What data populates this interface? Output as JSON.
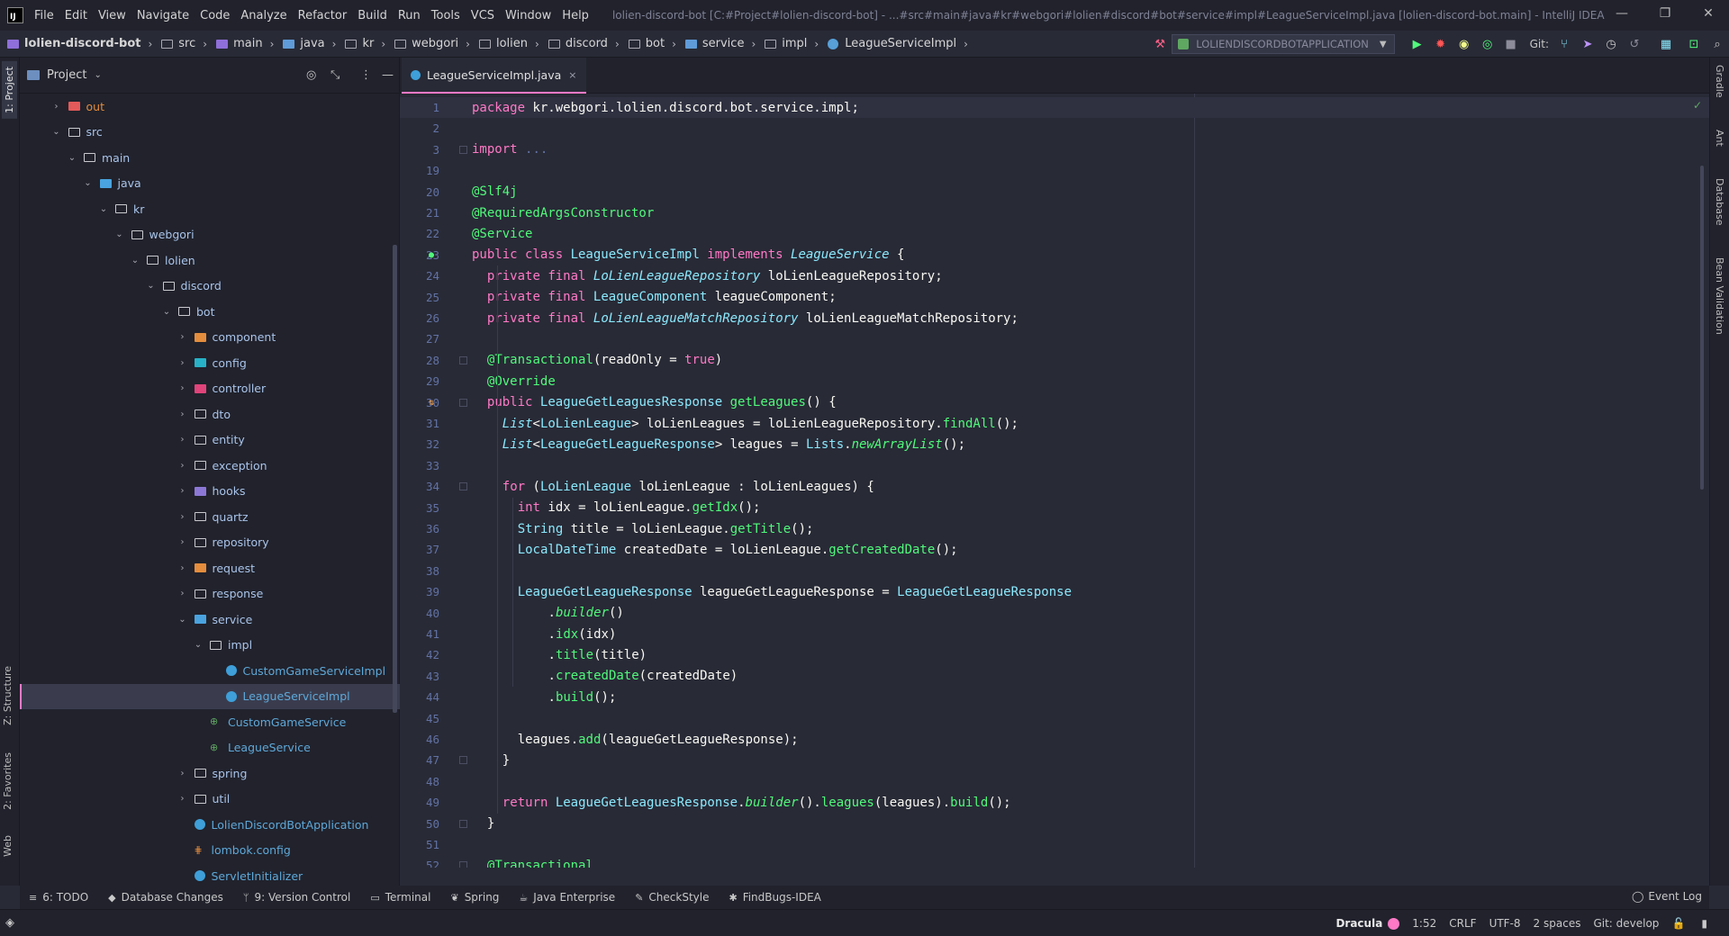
{
  "menubar": {
    "items": [
      "File",
      "Edit",
      "View",
      "Navigate",
      "Code",
      "Analyze",
      "Refactor",
      "Build",
      "Run",
      "Tools",
      "VCS",
      "Window",
      "Help"
    ],
    "window_title": "lolien-discord-bot [C:#Project#lolien-discord-bot] - ...#src#main#java#kr#webgori#lolien#discord#bot#service#impl#LeagueServiceImpl.java [lolien-discord-bot.main] - IntelliJ IDEA",
    "minimize": "—",
    "maximize": "❐",
    "close": "✕"
  },
  "breadcrumbs": [
    "lolien-discord-bot",
    "src",
    "main",
    "java",
    "kr",
    "webgori",
    "lolien",
    "discord",
    "bot",
    "service",
    "impl",
    "LeagueServiceImpl"
  ],
  "toolbar": {
    "run_config": "LOLIENDISCORDBOTAPPLICATION",
    "git_label": "Git:"
  },
  "left_stripe": {
    "project": "1: Project",
    "structure": "Z: Structure",
    "favorites": "2: Favorites",
    "web": "Web"
  },
  "right_stripe": {
    "gradle": "Gradle",
    "ant": "Ant",
    "database": "Database",
    "bean_validation": "Bean Validation"
  },
  "project_panel": {
    "title": "Project",
    "tree": [
      {
        "label": "out",
        "depth": 1,
        "twisty": "›",
        "icon": "red",
        "style": "out"
      },
      {
        "label": "src",
        "depth": 1,
        "twisty": "⌄",
        "icon": "plain",
        "style": "blue"
      },
      {
        "label": "main",
        "depth": 2,
        "twisty": "⌄",
        "icon": "plain",
        "style": "blue"
      },
      {
        "label": "java",
        "depth": 3,
        "twisty": "⌄",
        "icon": "blue",
        "style": "blue"
      },
      {
        "label": "kr",
        "depth": 4,
        "twisty": "⌄",
        "icon": "plain",
        "style": "blue"
      },
      {
        "label": "webgori",
        "depth": 5,
        "twisty": "⌄",
        "icon": "plain",
        "style": "blue"
      },
      {
        "label": "lolien",
        "depth": 6,
        "twisty": "⌄",
        "icon": "plain",
        "style": "blue"
      },
      {
        "label": "discord",
        "depth": 7,
        "twisty": "⌄",
        "icon": "plain",
        "style": "blue"
      },
      {
        "label": "bot",
        "depth": 8,
        "twisty": "⌄",
        "icon": "plain",
        "style": "blue"
      },
      {
        "label": "component",
        "depth": 9,
        "twisty": "›",
        "icon": "orange",
        "style": "blue"
      },
      {
        "label": "config",
        "depth": 9,
        "twisty": "›",
        "icon": "cyan",
        "style": "blue"
      },
      {
        "label": "controller",
        "depth": 9,
        "twisty": "›",
        "icon": "pink",
        "style": "blue"
      },
      {
        "label": "dto",
        "depth": 9,
        "twisty": "›",
        "icon": "plain",
        "style": "blue"
      },
      {
        "label": "entity",
        "depth": 9,
        "twisty": "›",
        "icon": "plain",
        "style": "blue"
      },
      {
        "label": "exception",
        "depth": 9,
        "twisty": "›",
        "icon": "plain",
        "style": "blue"
      },
      {
        "label": "hooks",
        "depth": 9,
        "twisty": "›",
        "icon": "lilac",
        "style": "blue"
      },
      {
        "label": "quartz",
        "depth": 9,
        "twisty": "›",
        "icon": "plain",
        "style": "blue"
      },
      {
        "label": "repository",
        "depth": 9,
        "twisty": "›",
        "icon": "plain",
        "style": "blue"
      },
      {
        "label": "request",
        "depth": 9,
        "twisty": "›",
        "icon": "orange",
        "style": "blue"
      },
      {
        "label": "response",
        "depth": 9,
        "twisty": "›",
        "icon": "plain",
        "style": "blue"
      },
      {
        "label": "service",
        "depth": 9,
        "twisty": "⌄",
        "icon": "blue",
        "style": "blue"
      },
      {
        "label": "impl",
        "depth": 10,
        "twisty": "⌄",
        "icon": "plain",
        "style": "blue"
      },
      {
        "label": "CustomGameServiceImpl",
        "depth": 11,
        "twisty": "",
        "icon": "class",
        "style": "cls"
      },
      {
        "label": "LeagueServiceImpl",
        "depth": 11,
        "twisty": "",
        "icon": "class",
        "style": "cls",
        "selected": true
      },
      {
        "label": "CustomGameService",
        "depth": 10,
        "twisty": "",
        "icon": "interface",
        "style": "cls"
      },
      {
        "label": "LeagueService",
        "depth": 10,
        "twisty": "",
        "icon": "interface",
        "style": "cls"
      },
      {
        "label": "spring",
        "depth": 9,
        "twisty": "›",
        "icon": "plain",
        "style": "blue"
      },
      {
        "label": "util",
        "depth": 9,
        "twisty": "›",
        "icon": "plain",
        "style": "blue"
      },
      {
        "label": "LolienDiscordBotApplication",
        "depth": 9,
        "twisty": "",
        "icon": "class",
        "style": "cls"
      },
      {
        "label": "lombok.config",
        "depth": 9,
        "twisty": "",
        "icon": "config",
        "style": "cls"
      },
      {
        "label": "ServletInitializer",
        "depth": 9,
        "twisty": "",
        "icon": "class",
        "style": "cls"
      }
    ]
  },
  "editor": {
    "tab_label": "LeagueServiceImpl.java",
    "tab_close": "×",
    "lines": [
      {
        "n": "1",
        "indent": 0,
        "current": true,
        "tokens": [
          [
            "kw",
            "package "
          ],
          [
            "pl",
            "kr.webgori.lolien.discord.bot.service.impl;"
          ]
        ]
      },
      {
        "n": "2",
        "indent": 0,
        "tokens": []
      },
      {
        "n": "3",
        "indent": 0,
        "fold": true,
        "tokens": [
          [
            "kw",
            "import "
          ],
          [
            "fo",
            "..."
          ]
        ]
      },
      {
        "n": "19",
        "indent": 0,
        "tokens": []
      },
      {
        "n": "20",
        "indent": 0,
        "tokens": [
          [
            "an",
            "@Slf4j"
          ]
        ]
      },
      {
        "n": "21",
        "indent": 0,
        "tokens": [
          [
            "an",
            "@RequiredArgsConstructor"
          ]
        ]
      },
      {
        "n": "22",
        "indent": 0,
        "tokens": [
          [
            "an",
            "@Service"
          ]
        ]
      },
      {
        "n": "23",
        "indent": 0,
        "gutter": "impl",
        "tokens": [
          [
            "kw",
            "public class "
          ],
          [
            "ty",
            "LeagueServiceImpl "
          ],
          [
            "kw",
            "implements "
          ],
          [
            "ity",
            "LeagueService"
          ],
          [
            "pl",
            " {"
          ]
        ]
      },
      {
        "n": "24",
        "indent": 2,
        "tokens": [
          [
            "kw",
            "private final "
          ],
          [
            "ity",
            "LoLienLeagueRepository"
          ],
          [
            "pl",
            " loLienLeagueRepository;"
          ]
        ]
      },
      {
        "n": "25",
        "indent": 2,
        "tokens": [
          [
            "kw",
            "private final "
          ],
          [
            "ty",
            "LeagueComponent"
          ],
          [
            "pl",
            " leagueComponent;"
          ]
        ]
      },
      {
        "n": "26",
        "indent": 2,
        "tokens": [
          [
            "kw",
            "private final "
          ],
          [
            "ity",
            "LoLienLeagueMatchRepository"
          ],
          [
            "pl",
            " loLienLeagueMatchRepository;"
          ]
        ]
      },
      {
        "n": "27",
        "indent": 0,
        "tokens": []
      },
      {
        "n": "28",
        "indent": 2,
        "fold": true,
        "tokens": [
          [
            "an",
            "@Transactional"
          ],
          [
            "pl",
            "(readOnly = "
          ],
          [
            "kw",
            "true"
          ],
          [
            "pl",
            ")"
          ]
        ]
      },
      {
        "n": "29",
        "indent": 2,
        "tokens": [
          [
            "an",
            "@Override"
          ]
        ]
      },
      {
        "n": "30",
        "indent": 2,
        "gutter": "override",
        "fold": true,
        "tokens": [
          [
            "kw",
            "public "
          ],
          [
            "ty",
            "LeagueGetLeaguesResponse "
          ],
          [
            "fn",
            "getLeagues"
          ],
          [
            "pl",
            "() {"
          ]
        ]
      },
      {
        "n": "31",
        "indent": 4,
        "tokens": [
          [
            "ity",
            "List"
          ],
          [
            "pl",
            "<"
          ],
          [
            "ty",
            "LoLienLeague"
          ],
          [
            "pl",
            "> loLienLeagues = loLienLeagueRepository."
          ],
          [
            "fn",
            "findAll"
          ],
          [
            "pl",
            "();"
          ]
        ]
      },
      {
        "n": "32",
        "indent": 4,
        "tokens": [
          [
            "ity",
            "List"
          ],
          [
            "pl",
            "<"
          ],
          [
            "ty",
            "LeagueGetLeagueResponse"
          ],
          [
            "pl",
            "> leagues = "
          ],
          [
            "ty",
            "Lists"
          ],
          [
            "pl",
            "."
          ],
          [
            "ifn",
            "newArrayList"
          ],
          [
            "pl",
            "();"
          ]
        ]
      },
      {
        "n": "33",
        "indent": 0,
        "tokens": []
      },
      {
        "n": "34",
        "indent": 4,
        "fold": true,
        "tokens": [
          [
            "kw",
            "for "
          ],
          [
            "pl",
            "("
          ],
          [
            "ty",
            "LoLienLeague"
          ],
          [
            "pl",
            " loLienLeague : loLienLeagues) {"
          ]
        ]
      },
      {
        "n": "35",
        "indent": 6,
        "tokens": [
          [
            "kw",
            "int "
          ],
          [
            "pl",
            "idx = loLienLeague."
          ],
          [
            "fn",
            "getIdx"
          ],
          [
            "pl",
            "();"
          ]
        ]
      },
      {
        "n": "36",
        "indent": 6,
        "tokens": [
          [
            "ty",
            "String "
          ],
          [
            "pl",
            "title = loLienLeague."
          ],
          [
            "fn",
            "getTitle"
          ],
          [
            "pl",
            "();"
          ]
        ]
      },
      {
        "n": "37",
        "indent": 6,
        "tokens": [
          [
            "ty",
            "LocalDateTime "
          ],
          [
            "pl",
            "createdDate = loLienLeague."
          ],
          [
            "fn",
            "getCreatedDate"
          ],
          [
            "pl",
            "();"
          ]
        ]
      },
      {
        "n": "38",
        "indent": 0,
        "tokens": []
      },
      {
        "n": "39",
        "indent": 6,
        "tokens": [
          [
            "ty",
            "LeagueGetLeagueResponse "
          ],
          [
            "pl",
            "leagueGetLeagueResponse = "
          ],
          [
            "ty",
            "LeagueGetLeagueResponse"
          ]
        ]
      },
      {
        "n": "40",
        "indent": 10,
        "tokens": [
          [
            "pl",
            "."
          ],
          [
            "ifn",
            "builder"
          ],
          [
            "pl",
            "()"
          ]
        ]
      },
      {
        "n": "41",
        "indent": 10,
        "tokens": [
          [
            "pl",
            "."
          ],
          [
            "fn",
            "idx"
          ],
          [
            "pl",
            "(idx)"
          ]
        ]
      },
      {
        "n": "42",
        "indent": 10,
        "tokens": [
          [
            "pl",
            "."
          ],
          [
            "fn",
            "title"
          ],
          [
            "pl",
            "(title)"
          ]
        ]
      },
      {
        "n": "43",
        "indent": 10,
        "tokens": [
          [
            "pl",
            "."
          ],
          [
            "fn",
            "createdDate"
          ],
          [
            "pl",
            "(createdDate)"
          ]
        ]
      },
      {
        "n": "44",
        "indent": 10,
        "tokens": [
          [
            "pl",
            "."
          ],
          [
            "fn",
            "build"
          ],
          [
            "pl",
            "();"
          ]
        ]
      },
      {
        "n": "45",
        "indent": 0,
        "tokens": []
      },
      {
        "n": "46",
        "indent": 6,
        "tokens": [
          [
            "pl",
            "leagues."
          ],
          [
            "fn",
            "add"
          ],
          [
            "pl",
            "(leagueGetLeagueResponse);"
          ]
        ]
      },
      {
        "n": "47",
        "indent": 4,
        "fold": true,
        "tokens": [
          [
            "pl",
            "}"
          ]
        ]
      },
      {
        "n": "48",
        "indent": 0,
        "tokens": []
      },
      {
        "n": "49",
        "indent": 4,
        "tokens": [
          [
            "kw",
            "return "
          ],
          [
            "ty",
            "LeagueGetLeaguesResponse"
          ],
          [
            "pl",
            "."
          ],
          [
            "ifn",
            "builder"
          ],
          [
            "pl",
            "()."
          ],
          [
            "fn",
            "leagues"
          ],
          [
            "pl",
            "(leagues)."
          ],
          [
            "fn",
            "build"
          ],
          [
            "pl",
            "();"
          ]
        ]
      },
      {
        "n": "50",
        "indent": 2,
        "fold": true,
        "tokens": [
          [
            "pl",
            "}"
          ]
        ]
      },
      {
        "n": "51",
        "indent": 0,
        "tokens": []
      },
      {
        "n": "52",
        "indent": 2,
        "fold": true,
        "tokens": [
          [
            "an",
            "@Transactional"
          ]
        ]
      }
    ]
  },
  "bottom_tabs": [
    {
      "label": "6: TODO",
      "icon": "≡"
    },
    {
      "label": "Database Changes",
      "icon": "◆"
    },
    {
      "label": "9: Version Control",
      "icon": "ᛘ"
    },
    {
      "label": "Terminal",
      "icon": "▭"
    },
    {
      "label": "Spring",
      "icon": "❦"
    },
    {
      "label": "Java Enterprise",
      "icon": "☕"
    },
    {
      "label": "CheckStyle",
      "icon": "✎"
    },
    {
      "label": "FindBugs-IDEA",
      "icon": "✱"
    }
  ],
  "event_log": "Event Log",
  "status": {
    "theme": "Dracula",
    "position": "1:52",
    "line_sep": "CRLF",
    "encoding": "UTF-8",
    "indent": "2 spaces",
    "git_branch": "Git: develop"
  },
  "colors": {
    "background": "#282a36",
    "accent": "#ff79c6",
    "keyword": "#ff79c6",
    "type": "#8be9fd",
    "annotation": "#50fa7b"
  }
}
